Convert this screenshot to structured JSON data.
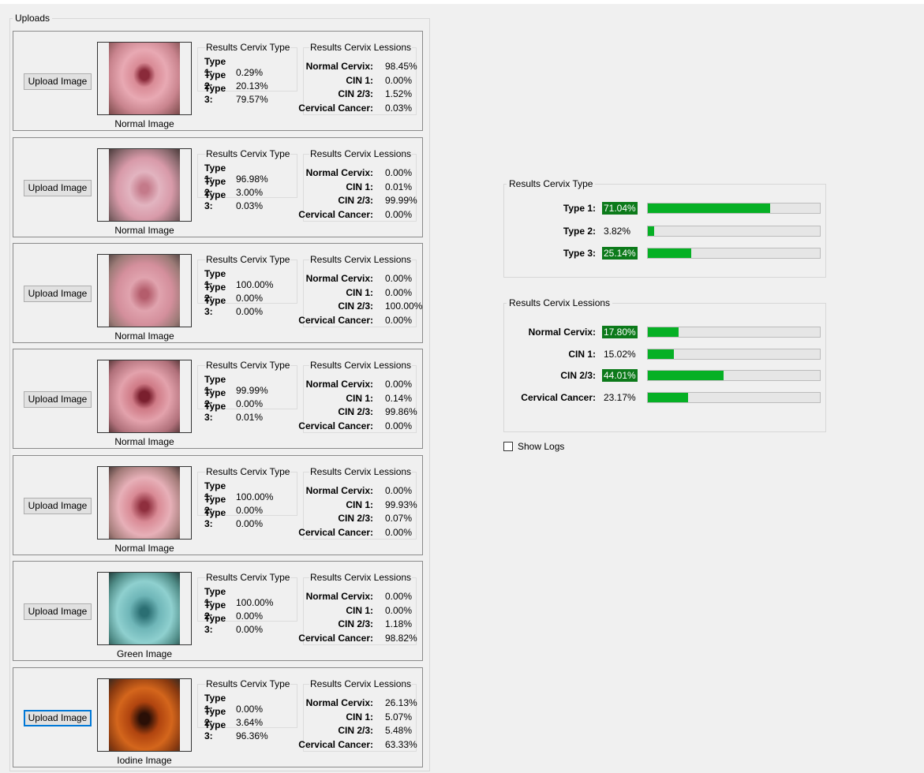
{
  "uploads_title": "Uploads",
  "cards": [
    {
      "button_label": "Upload Image",
      "image_label": "Normal Image",
      "type_title": "Results Cervix Type",
      "types": [
        [
          "Type 1:",
          "0.29%"
        ],
        [
          "Type 2:",
          "20.13%"
        ],
        [
          "Type 3:",
          "79.57%"
        ]
      ],
      "lesions_title": "Results Cervix Lessions",
      "lesions": [
        [
          "Normal Cervix:",
          "98.45%"
        ],
        [
          "CIN 1:",
          "0.00%"
        ],
        [
          "CIN 2/3:",
          "1.52%"
        ],
        [
          "Cervical Cancer:",
          "0.03%"
        ]
      ]
    },
    {
      "button_label": "Upload Image",
      "image_label": "Normal Image",
      "type_title": "Results Cervix Type",
      "types": [
        [
          "Type 1:",
          "96.98%"
        ],
        [
          "Type 2:",
          "3.00%"
        ],
        [
          "Type 3:",
          "0.03%"
        ]
      ],
      "lesions_title": "Results Cervix Lessions",
      "lesions": [
        [
          "Normal Cervix:",
          "0.00%"
        ],
        [
          "CIN 1:",
          "0.01%"
        ],
        [
          "CIN 2/3:",
          "99.99%"
        ],
        [
          "Cervical Cancer:",
          "0.00%"
        ]
      ]
    },
    {
      "button_label": "Upload Image",
      "image_label": "Normal Image",
      "type_title": "Results Cervix Type",
      "types": [
        [
          "Type 1:",
          "100.00%"
        ],
        [
          "Type 2:",
          "0.00%"
        ],
        [
          "Type 3:",
          "0.00%"
        ]
      ],
      "lesions_title": "Results Cervix Lessions",
      "lesions": [
        [
          "Normal Cervix:",
          "0.00%"
        ],
        [
          "CIN 1:",
          "0.00%"
        ],
        [
          "CIN 2/3:",
          "100.00%"
        ],
        [
          "Cervical Cancer:",
          "0.00%"
        ]
      ]
    },
    {
      "button_label": "Upload Image",
      "image_label": "Normal Image",
      "type_title": "Results Cervix Type",
      "types": [
        [
          "Type 1:",
          "99.99%"
        ],
        [
          "Type 2:",
          "0.00%"
        ],
        [
          "Type 3:",
          "0.01%"
        ]
      ],
      "lesions_title": "Results Cervix Lessions",
      "lesions": [
        [
          "Normal Cervix:",
          "0.00%"
        ],
        [
          "CIN 1:",
          "0.14%"
        ],
        [
          "CIN 2/3:",
          "99.86%"
        ],
        [
          "Cervical Cancer:",
          "0.00%"
        ]
      ]
    },
    {
      "button_label": "Upload Image",
      "image_label": "Normal Image",
      "type_title": "Results Cervix Type",
      "types": [
        [
          "Type 1:",
          "100.00%"
        ],
        [
          "Type 2:",
          "0.00%"
        ],
        [
          "Type 3:",
          "0.00%"
        ]
      ],
      "lesions_title": "Results Cervix Lessions",
      "lesions": [
        [
          "Normal Cervix:",
          "0.00%"
        ],
        [
          "CIN 1:",
          "99.93%"
        ],
        [
          "CIN 2/3:",
          "0.07%"
        ],
        [
          "Cervical Cancer:",
          "0.00%"
        ]
      ]
    },
    {
      "button_label": "Upload Image",
      "image_label": "Green Image",
      "type_title": "Results Cervix Type",
      "types": [
        [
          "Type 1:",
          "100.00%"
        ],
        [
          "Type 2:",
          "0.00%"
        ],
        [
          "Type 3:",
          "0.00%"
        ]
      ],
      "lesions_title": "Results Cervix Lessions",
      "lesions": [
        [
          "Normal Cervix:",
          "0.00%"
        ],
        [
          "CIN 1:",
          "0.00%"
        ],
        [
          "CIN 2/3:",
          "1.18%"
        ],
        [
          "Cervical Cancer:",
          "98.82%"
        ]
      ]
    },
    {
      "button_label": "Upload Image",
      "image_label": "Iodine Image",
      "type_title": "Results Cervix Type",
      "types": [
        [
          "Type 1:",
          "0.00%"
        ],
        [
          "Type 2:",
          "3.64%"
        ],
        [
          "Type 3:",
          "96.36%"
        ]
      ],
      "lesions_title": "Results Cervix Lessions",
      "lesions": [
        [
          "Normal Cervix:",
          "26.13%"
        ],
        [
          "CIN 1:",
          "5.07%"
        ],
        [
          "CIN 2/3:",
          "5.48%"
        ],
        [
          "Cervical Cancer:",
          "63.33%"
        ]
      ]
    }
  ],
  "summary_type": {
    "title": "Results Cervix Type",
    "rows": [
      {
        "label": "Type 1:",
        "value": "71.04%",
        "fraction": 0.7104,
        "highlight": true
      },
      {
        "label": "Type 2:",
        "value": "3.82%",
        "fraction": 0.0382,
        "highlight": false
      },
      {
        "label": "Type 3:",
        "value": "25.14%",
        "fraction": 0.2514,
        "highlight": true
      }
    ]
  },
  "summary_lesions": {
    "title": "Results Cervix Lessions",
    "rows": [
      {
        "label": "Normal Cervix:",
        "value": "17.80%",
        "fraction": 0.178,
        "highlight": true
      },
      {
        "label": "CIN 1:",
        "value": "15.02%",
        "fraction": 0.1502,
        "highlight": false
      },
      {
        "label": "CIN 2/3:",
        "value": "44.01%",
        "fraction": 0.4401,
        "highlight": true
      },
      {
        "label": "Cervical Cancer:",
        "value": "23.17%",
        "fraction": 0.2317,
        "highlight": false
      }
    ]
  },
  "show_logs_label": "Show Logs",
  "colors": {
    "bar_fill": "#06b025",
    "value_highlight_bg": "#0c7a1a",
    "focus_border": "#0078d7"
  }
}
